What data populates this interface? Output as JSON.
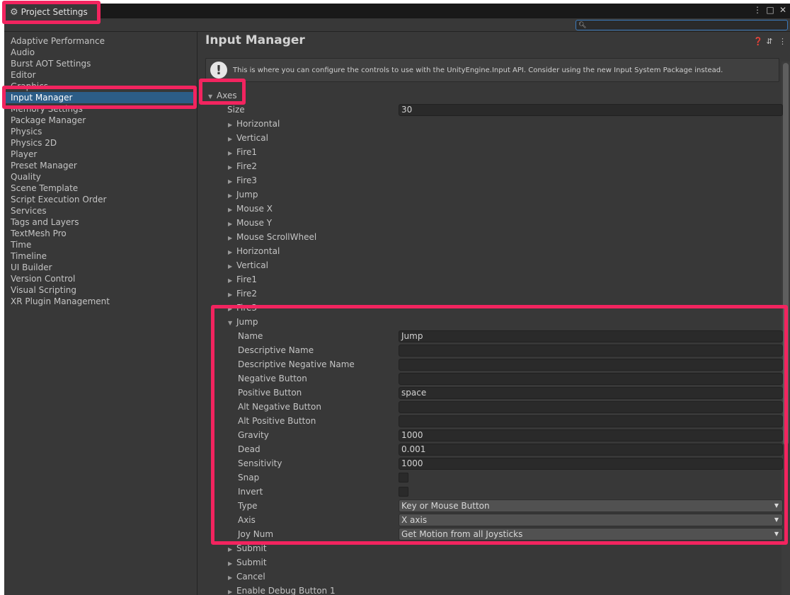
{
  "window": {
    "title": "Project Settings",
    "controls": [
      "⋮",
      "□",
      "✕"
    ]
  },
  "search": {
    "placeholder": "",
    "value": ""
  },
  "sidebar": {
    "items": [
      {
        "label": "Adaptive Performance"
      },
      {
        "label": "Audio"
      },
      {
        "label": "Burst AOT Settings"
      },
      {
        "label": "Editor"
      },
      {
        "label": "Graphics"
      },
      {
        "label": "Input Manager",
        "selected": true
      },
      {
        "label": "Memory Settings"
      },
      {
        "label": "Package Manager"
      },
      {
        "label": "Physics"
      },
      {
        "label": "Physics 2D"
      },
      {
        "label": "Player"
      },
      {
        "label": "Preset Manager"
      },
      {
        "label": "Quality"
      },
      {
        "label": "Scene Template"
      },
      {
        "label": "Script Execution Order"
      },
      {
        "label": "Services"
      },
      {
        "label": "Tags and Layers"
      },
      {
        "label": "TextMesh Pro"
      },
      {
        "label": "Time"
      },
      {
        "label": "Timeline"
      },
      {
        "label": "UI Builder"
      },
      {
        "label": "Version Control"
      },
      {
        "label": "Visual Scripting"
      },
      {
        "label": "XR Plugin Management"
      }
    ]
  },
  "main": {
    "title": "Input Manager",
    "help_text": "This is where you can configure the controls to use with the UnityEngine.Input API. Consider using the new Input System Package instead.",
    "axes_label": "Axes",
    "size_label": "Size",
    "size_value": "30",
    "collapsed_axes_top": [
      "Horizontal",
      "Vertical",
      "Fire1",
      "Fire2",
      "Fire3",
      "Jump",
      "Mouse X",
      "Mouse Y",
      "Mouse ScrollWheel",
      "Horizontal",
      "Vertical",
      "Fire1",
      "Fire2",
      "Fire3"
    ],
    "expanded_axis": {
      "label": "Jump",
      "fields": {
        "name": {
          "label": "Name",
          "value": "Jump"
        },
        "descriptive_name": {
          "label": "Descriptive Name",
          "value": ""
        },
        "descriptive_negative_name": {
          "label": "Descriptive Negative Name",
          "value": ""
        },
        "negative_button": {
          "label": "Negative Button",
          "value": ""
        },
        "positive_button": {
          "label": "Positive Button",
          "value": "space"
        },
        "alt_negative_button": {
          "label": "Alt Negative Button",
          "value": ""
        },
        "alt_positive_button": {
          "label": "Alt Positive Button",
          "value": ""
        },
        "gravity": {
          "label": "Gravity",
          "value": "1000"
        },
        "dead": {
          "label": "Dead",
          "value": "0.001"
        },
        "sensitivity": {
          "label": "Sensitivity",
          "value": "1000"
        },
        "snap": {
          "label": "Snap",
          "checked": false
        },
        "invert": {
          "label": "Invert",
          "checked": false
        },
        "type": {
          "label": "Type",
          "value": "Key or Mouse Button"
        },
        "axis": {
          "label": "Axis",
          "value": "X axis"
        },
        "joy_num": {
          "label": "Joy Num",
          "value": "Get Motion from all Joysticks"
        }
      }
    },
    "collapsed_axes_bottom": [
      "Submit",
      "Submit",
      "Cancel",
      "Enable Debug Button 1"
    ]
  },
  "colors": {
    "highlight": "#f2245f",
    "selection": "#2c5d87",
    "panel": "#383838",
    "field": "#2a2a2a"
  }
}
